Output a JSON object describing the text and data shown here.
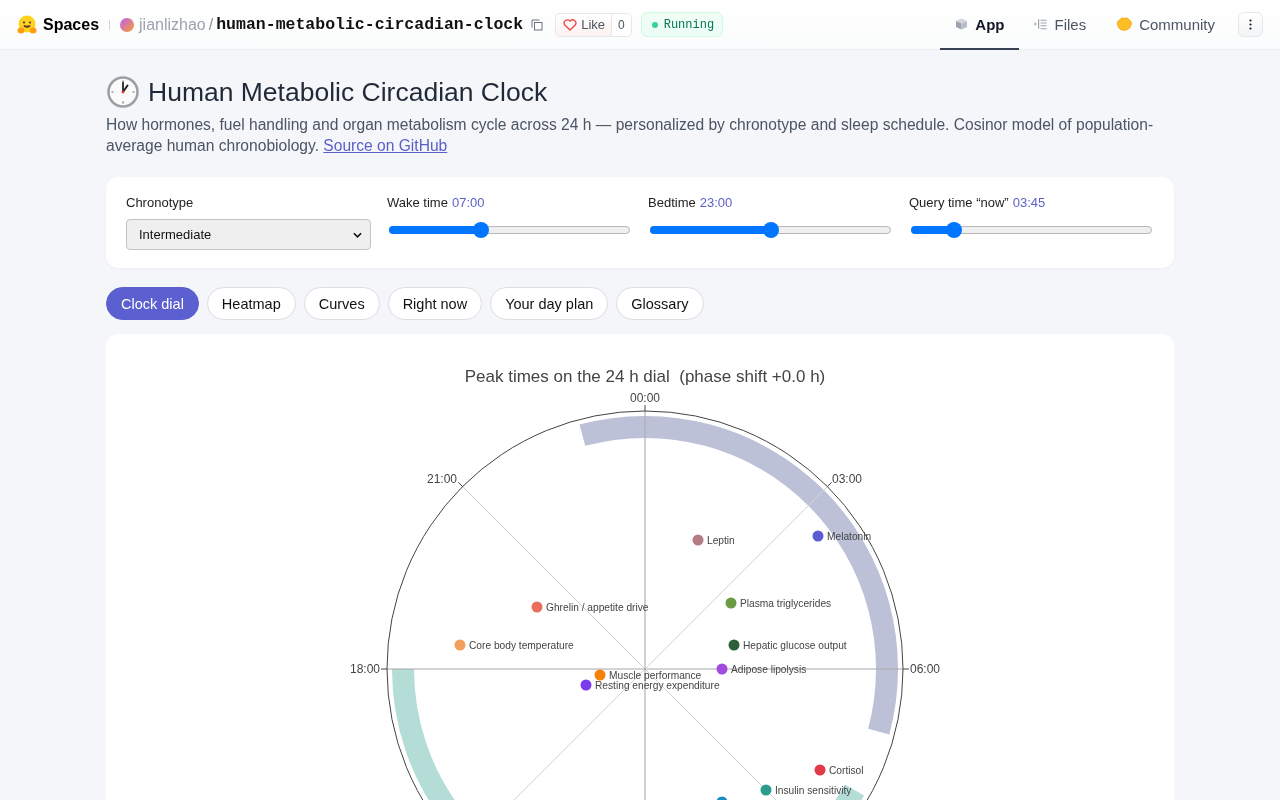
{
  "header": {
    "brand": "Spaces",
    "owner": "jianlizhao",
    "separator": "/",
    "repo": "human-metabolic-circadian-clock",
    "like": {
      "label": "Like",
      "count": "0"
    },
    "status": "Running",
    "nav": [
      {
        "label": "App",
        "selected": true
      },
      {
        "label": "Files",
        "selected": false
      },
      {
        "label": "Community",
        "selected": false
      }
    ]
  },
  "page": {
    "title": "Human Metabolic Circadian Clock",
    "description": "How hormones, fuel handling and organ metabolism cycle across 24 h — personalized by chronotype and sleep schedule. Cosinor model of population-average human chronobiology.",
    "link": "Source on GitHub"
  },
  "controls": {
    "select": {
      "label": "Chronotype",
      "value": "Intermediate"
    },
    "sliders": [
      {
        "label": "Wake time",
        "reading": "07:00",
        "level": 0.375
      },
      {
        "label": "Bedtime",
        "reading": "23:00",
        "level": 0.5
      },
      {
        "label": "Query time “now”",
        "reading": "03:45",
        "level": 0.156
      }
    ]
  },
  "tabs": [
    {
      "label": "Clock dial",
      "selected": true
    },
    {
      "label": "Heatmap",
      "selected": false
    },
    {
      "label": "Curves",
      "selected": false
    },
    {
      "label": "Right now",
      "selected": false
    },
    {
      "label": "Your day plan",
      "selected": false
    },
    {
      "label": "Glossary",
      "selected": false
    }
  ],
  "dial": {
    "title": "Peak times on the 24 h dial  (phase shift +0.0 h)",
    "tick_labels": [
      "00:00",
      "03:00",
      "06:00",
      "18:00",
      "21:00"
    ],
    "markers": [
      {
        "label": "Leptin",
        "color": "#b57b86"
      },
      {
        "label": "Melatonin",
        "color": "#5b5bd6"
      },
      {
        "label": "Ghrelin / appetite drive",
        "color": "#e8705a"
      },
      {
        "label": "Plasma triglycerides",
        "color": "#6b9b45"
      },
      {
        "label": "Core body temperature",
        "color": "#f2a05e"
      },
      {
        "label": "Hepatic glucose output",
        "color": "#2d5f3a"
      },
      {
        "label": "Adipose lipolysis",
        "color": "#a04be0"
      },
      {
        "label": "Muscle performance",
        "color": "#f5800a"
      },
      {
        "label": "Resting energy expenditure",
        "color": "#7c3aed"
      },
      {
        "label": "Cortisol",
        "color": "#e23a4a"
      },
      {
        "label": "Insulin sensitivity",
        "color": "#2a9d8f"
      },
      {
        "color": "#1d8bc4"
      }
    ]
  }
}
